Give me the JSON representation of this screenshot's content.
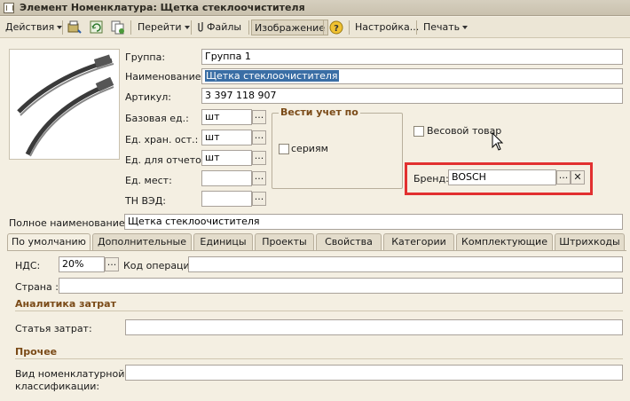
{
  "window": {
    "title": "Элемент Номенклатура: Щетка стеклоочистителя"
  },
  "toolbar": {
    "actions": "Действия",
    "goto": "Перейти",
    "files": "Файлы",
    "image": "Изображение",
    "help": "?",
    "settings": "Настройка...",
    "print": "Печать"
  },
  "form": {
    "group_label": "Группа:",
    "group_value": "Группа 1",
    "name_label": "Наименование:",
    "name_value": "Щетка стеклоочистителя",
    "article_label": "Артикул:",
    "article_value": "3 397 118 907",
    "base_unit_label": "Базовая ед.:",
    "base_unit_value": "шт",
    "storage_unit_label": "Ед. хран. ост.:",
    "storage_unit_value": "шт",
    "report_unit_label": "Ед. для отчетов:",
    "report_unit_value": "шт",
    "places_unit_label": "Ед. мест:",
    "places_unit_value": "",
    "tnved_label": "ТН ВЭД:",
    "tnved_value": "",
    "track_by_title": "Вести учет по",
    "series_label": "сериям",
    "weight_item_label": "Весовой товар",
    "brand_label": "Бренд:",
    "brand_value": "BOSCH",
    "full_name_label": "Полное наименование:",
    "full_name_value": "Щетка стеклоочистителя"
  },
  "tabs": [
    {
      "label": "По умолчанию"
    },
    {
      "label": "Дополнительные"
    },
    {
      "label": "Единицы"
    },
    {
      "label": "Проекты"
    },
    {
      "label": "Свойства"
    },
    {
      "label": "Категории"
    },
    {
      "label": "Комплектующие"
    },
    {
      "label": "Штрихкоды"
    }
  ],
  "tab_default": {
    "vat_label": "НДС:",
    "vat_value": "20%",
    "operation_code_label": "Код операции:",
    "operation_code_value": "",
    "country_label": "Страна :",
    "country_value": "",
    "cost_analytics_title": "Аналитика затрат",
    "cost_item_label": "Статья затрат:",
    "cost_item_value": "",
    "other_title": "Прочее",
    "nomenclature_type_label_1": "Вид номенклатурной",
    "nomenclature_type_label_2": "классификации:",
    "nomenclature_type_value": ""
  },
  "colors": {
    "highlight": "#e23030",
    "section": "#7a4a17",
    "selection": "#3a6ea5"
  },
  "icons": [
    "app-icon",
    "folder-icon",
    "refresh-icon",
    "copy-icon",
    "paperclip-icon",
    "help-icon",
    "ellipsis-icon",
    "clear-icon",
    "mouse-cursor-icon"
  ]
}
